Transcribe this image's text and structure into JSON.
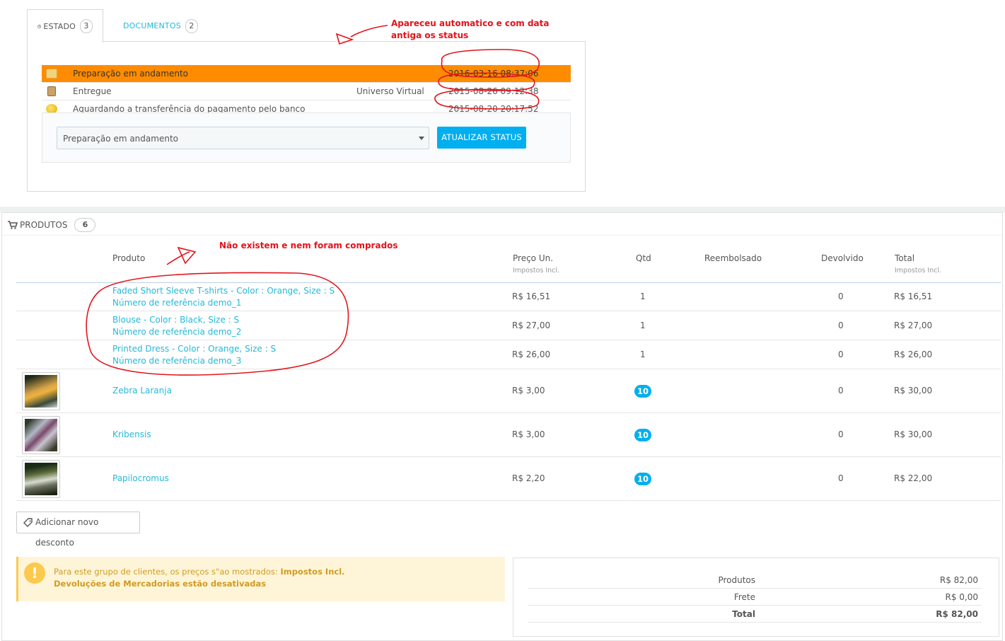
{
  "tabs": {
    "estado": {
      "label": "ESTADO",
      "count": "3"
    },
    "documentos": {
      "label": "DOCUMENTOS",
      "count": "2"
    }
  },
  "history": [
    {
      "label": "Preparação em andamento",
      "employee": "",
      "date": "2016-03-16 08:37:06",
      "icon": "package-icon",
      "color": "#ff8c00"
    },
    {
      "label": "Entregue",
      "employee": "Universo Virtual",
      "date": "2015-08-26 09:12:38",
      "icon": "box-icon"
    },
    {
      "label": "Aguardando a transferência do pagamento pelo banco",
      "employee": "",
      "date": "2015-08-20 20:17:52",
      "icon": "coins-icon"
    }
  ],
  "status_form": {
    "selected": "Preparação em andamento",
    "button": "ATUALIZAR STATUS"
  },
  "annotations": {
    "top": "Apareceu automatico e com data antiga os status",
    "products": "Não existem e nem foram comprados"
  },
  "products_panel": {
    "title": "PRODUTOS",
    "count": "6",
    "headers": {
      "produto": "Produto",
      "preco": "Preço Un.",
      "preco_sub": "Impostos Incl.",
      "qtd": "Qtd",
      "reembolsado": "Reembolsado",
      "devolvido": "Devolvido",
      "total": "Total",
      "total_sub": "Impostos Incl."
    },
    "rows": [
      {
        "name": "Faded Short Sleeve T-shirts - Color : Orange, Size : S",
        "ref": "Número de referência demo_1",
        "price": "R$ 16,51",
        "qty": "1",
        "returned": "0",
        "total": "R$ 16,51"
      },
      {
        "name": "Blouse - Color : Black, Size : S",
        "ref": "Número de referência demo_2",
        "price": "R$ 27,00",
        "qty": "1",
        "returned": "0",
        "total": "R$ 27,00"
      },
      {
        "name": "Printed Dress - Color : Orange, Size : S",
        "ref": "Número de referência demo_3",
        "price": "R$ 26,00",
        "qty": "1",
        "returned": "0",
        "total": "R$ 26,00"
      },
      {
        "name": "Zebra Laranja",
        "price": "R$ 3,00",
        "qty": "10",
        "returned": "0",
        "total": "R$ 30,00"
      },
      {
        "name": "Kribensis",
        "price": "R$ 3,00",
        "qty": "10",
        "returned": "0",
        "total": "R$ 30,00"
      },
      {
        "name": "Papilocromus",
        "price": "R$ 2,20",
        "qty": "10",
        "returned": "0",
        "total": "R$ 22,00"
      }
    ],
    "add_discount": "Adicionar novo desconto"
  },
  "warning": {
    "line1_prefix": "Para este grupo de clientes, os preços s\"ao mostrados:",
    "line1_bold": "Impostos Incl.",
    "line2": "Devoluções de Mercadorias estão desativadas"
  },
  "totals": [
    {
      "label": "Produtos",
      "value": "R$ 82,00"
    },
    {
      "label": "Frete",
      "value": "R$ 0,00"
    },
    {
      "label": "Total",
      "value": "R$ 82,00"
    }
  ]
}
